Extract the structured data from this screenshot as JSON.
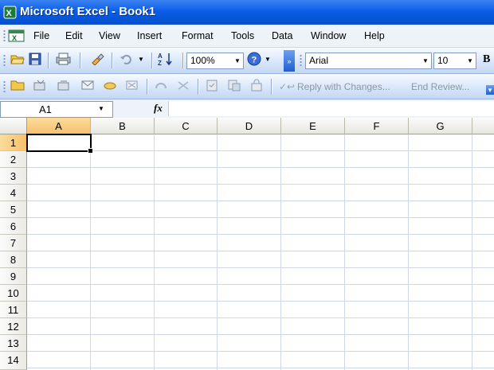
{
  "window": {
    "title": "Microsoft Excel - Book1"
  },
  "menu": [
    "File",
    "Edit",
    "View",
    "Insert",
    "Format",
    "Tools",
    "Data",
    "Window",
    "Help"
  ],
  "standard_toolbar": {
    "zoom": "100%"
  },
  "formatting_toolbar": {
    "font": "Arial",
    "size": "10",
    "bold": "B"
  },
  "reviewing_toolbar": {
    "reply": "Reply with Changes...",
    "end_review": "End Review..."
  },
  "formula_bar": {
    "name_box": "A1",
    "fx": "fx"
  },
  "grid": {
    "columns": [
      "A",
      "B",
      "C",
      "D",
      "E",
      "F",
      "G"
    ],
    "rows": [
      "1",
      "2",
      "3",
      "4",
      "5",
      "6",
      "7",
      "8",
      "9",
      "10",
      "11",
      "12",
      "13",
      "14"
    ],
    "active_cell": "A1"
  }
}
